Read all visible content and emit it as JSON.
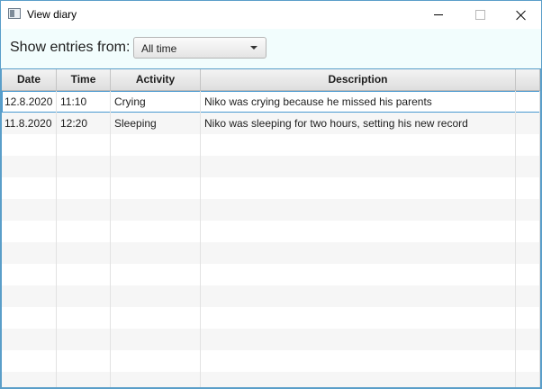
{
  "window": {
    "title": "View diary"
  },
  "filter": {
    "label": "Show entries from:",
    "selected": "All time"
  },
  "table": {
    "columns": [
      "Date",
      "Time",
      "Activity",
      "Description"
    ],
    "rows": [
      {
        "date": "12.8.2020",
        "time": "11:10",
        "activity": "Crying",
        "description": "Niko was crying because he missed his parents",
        "selected": true
      },
      {
        "date": "11.8.2020",
        "time": "12:20",
        "activity": "Sleeping",
        "description": "Niko was sleeping for two hours, setting his new record",
        "selected": false
      }
    ]
  }
}
